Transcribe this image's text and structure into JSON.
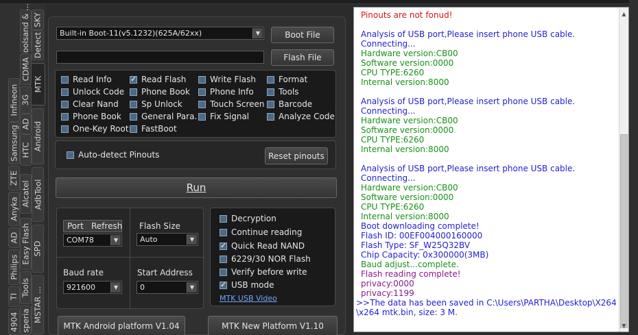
{
  "vtabs": [
    {
      "label": "SKY",
      "active": false
    },
    {
      "label": "Coolsand & ...",
      "active": false
    },
    {
      "label": "Detect",
      "active": false
    },
    {
      "label": "CDMA",
      "active": false
    },
    {
      "label": "MTK",
      "active": true
    },
    {
      "label": "3G",
      "active": false
    },
    {
      "label": "Infineon",
      "active": false
    },
    {
      "label": "AD",
      "active": false
    },
    {
      "label": "Android",
      "active": false
    },
    {
      "label": "HTC",
      "active": false
    },
    {
      "label": "Samsung",
      "active": false
    },
    {
      "label": "ZTE",
      "active": false
    },
    {
      "label": "Alcatel",
      "active": false
    },
    {
      "label": "AdbTool",
      "active": false
    },
    {
      "label": "Anyka",
      "active": false
    },
    {
      "label": "Easy Flash",
      "active": false
    },
    {
      "label": "AD",
      "active": false
    },
    {
      "label": "SPD",
      "active": false
    },
    {
      "label": "Philips",
      "active": false
    },
    {
      "label": "Tools",
      "active": false
    },
    {
      "label": "TI",
      "active": false
    },
    {
      "label": "MSTAR ...",
      "active": false
    },
    {
      "label": "4904",
      "active": false
    },
    {
      "label": "speria",
      "active": false
    }
  ],
  "boot": {
    "selected": "Built-in Boot-11(v5.1232)(625A/62xx)",
    "boot_file_label": "Boot File",
    "flash_path": "",
    "flash_file_label": "Flash File"
  },
  "operations": [
    {
      "label": "Read Info",
      "checked": false
    },
    {
      "label": "Read Flash",
      "checked": true
    },
    {
      "label": "Write Flash",
      "checked": false
    },
    {
      "label": "Format",
      "checked": false
    },
    {
      "label": "Unlock Code",
      "checked": false
    },
    {
      "label": "Phone Book",
      "checked": false
    },
    {
      "label": "Phone Info",
      "checked": false
    },
    {
      "label": "Tools",
      "checked": false
    },
    {
      "label": "Clear Nand",
      "checked": false
    },
    {
      "label": "Sp Unlock",
      "checked": false
    },
    {
      "label": "Touch Screen",
      "checked": false
    },
    {
      "label": "Barcode",
      "checked": false
    },
    {
      "label": "Phone Book",
      "checked": false
    },
    {
      "label": "General Para.",
      "checked": false
    },
    {
      "label": "Fix Signal",
      "checked": false
    },
    {
      "label": "Analyze Code",
      "checked": false
    },
    {
      "label": "One-Key Root",
      "checked": false
    },
    {
      "label": "FastBoot",
      "checked": false
    }
  ],
  "pinouts": {
    "auto_detect_label": "Auto-detect Pinouts",
    "auto_detect_checked": false,
    "reset_label": "Reset pinouts"
  },
  "run_label": "Run",
  "port": {
    "port_label": "Port",
    "refresh_label": "Refresh",
    "port_value": "COM78",
    "flash_size_label": "Flash Size",
    "flash_size_value": "Auto",
    "baud_label": "Baud rate",
    "baud_value": "921600",
    "start_address_label": "Start Address",
    "start_address_value": "0"
  },
  "options": [
    {
      "label": "Decryption",
      "checked": false
    },
    {
      "label": "Continue reading",
      "checked": false
    },
    {
      "label": "Quick Read NAND",
      "checked": true
    },
    {
      "label": "6229/30 NOR Flash",
      "checked": false
    },
    {
      "label": "Verify before write",
      "checked": false
    },
    {
      "label": "USB mode",
      "checked": true
    }
  ],
  "usb_video_link": "MTK USB Video",
  "platform_buttons": {
    "android": "MTK Android platform V1.04",
    "new": "MTK New Platform V1.10"
  },
  "log": [
    {
      "text": "Pinouts are not fonud!",
      "color": "red"
    },
    {
      "text": "",
      "color": "blue"
    },
    {
      "text": "Analysis of USB port,Please insert phone USB cable.",
      "color": "blue"
    },
    {
      "text": "Connecting...",
      "color": "blue"
    },
    {
      "text": "Hardware version:CB00",
      "color": "green"
    },
    {
      "text": "Software version:0000",
      "color": "green"
    },
    {
      "text": "CPU TYPE:6260",
      "color": "green"
    },
    {
      "text": "Internal version:8000",
      "color": "green"
    },
    {
      "text": "",
      "color": "blue"
    },
    {
      "text": "Analysis of USB port,Please insert phone USB cable.",
      "color": "blue"
    },
    {
      "text": "Connecting...",
      "color": "blue"
    },
    {
      "text": "Hardware version:CB00",
      "color": "green"
    },
    {
      "text": "Software version:0000",
      "color": "green"
    },
    {
      "text": "CPU TYPE:6260",
      "color": "green"
    },
    {
      "text": "Internal version:8000",
      "color": "green"
    },
    {
      "text": "",
      "color": "blue"
    },
    {
      "text": "Analysis of USB port,Please insert phone USB cable.",
      "color": "blue"
    },
    {
      "text": "Connecting...",
      "color": "blue"
    },
    {
      "text": "Hardware version:CB00",
      "color": "green"
    },
    {
      "text": "Software version:0000",
      "color": "green"
    },
    {
      "text": "CPU TYPE:6260",
      "color": "green"
    },
    {
      "text": "Internal version:8000",
      "color": "green"
    },
    {
      "text": "Boot downloading complete!",
      "color": "blue"
    },
    {
      "text": "Flash ID: 00EF004000160000",
      "color": "blue"
    },
    {
      "text": "Flash Type: SF_W25Q32BV",
      "color": "blue"
    },
    {
      "text": "Chip Capacity: 0x300000(3MB)",
      "color": "blue"
    },
    {
      "text": "Baud adjust...complete.",
      "color": "green"
    },
    {
      "text": "Flash reading complete!",
      "color": "purple"
    },
    {
      "text": "privacy:0000",
      "color": "purple"
    },
    {
      "text": "privacy:1199",
      "color": "purple"
    },
    {
      "text": ">>The data has been saved in C:\\Users\\PARTHA\\Desktop\\X264",
      "color": "blue"
    },
    {
      "text": "\\x264 mtk.bin, size: 3 M.",
      "color": "blue"
    }
  ],
  "colors": {
    "log_red": "#d81414",
    "log_blue": "#1f1fd0",
    "log_green": "#199019",
    "log_purple": "#8a1a8a",
    "panel_bg": "#303030"
  }
}
